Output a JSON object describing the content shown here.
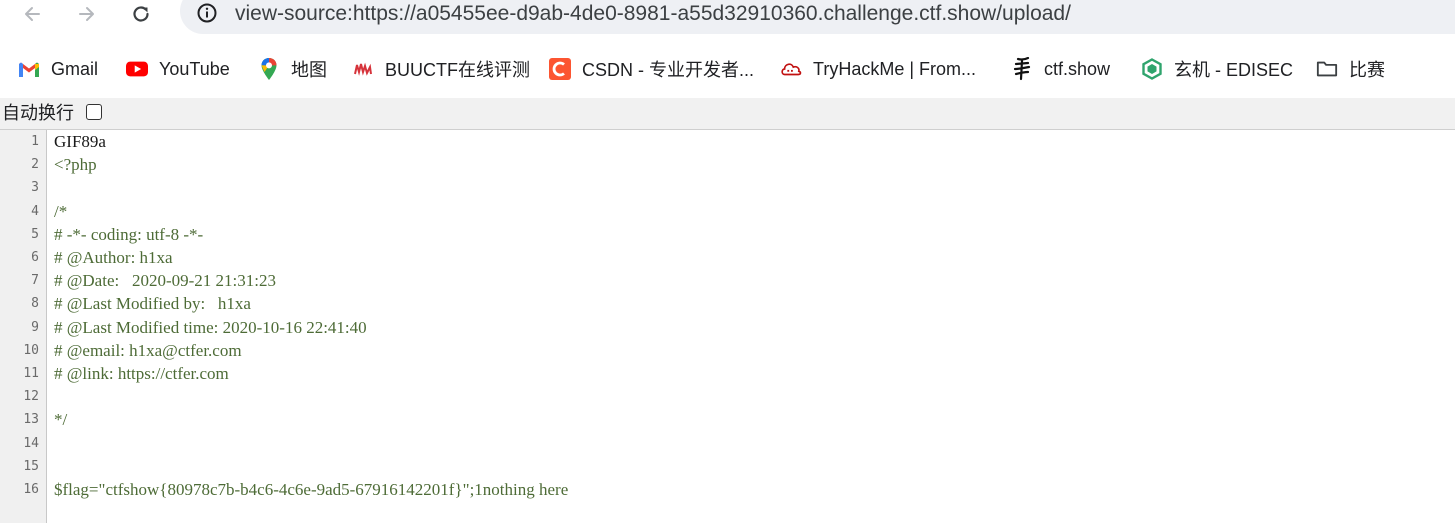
{
  "browser": {
    "url": "view-source:https://a05455ee-d9ab-4de0-8981-a55d32910360.challenge.ctf.show/upload/",
    "bookmarks": [
      {
        "label": "Gmail",
        "icon": "gmail-icon"
      },
      {
        "label": "YouTube",
        "icon": "youtube-icon"
      },
      {
        "label": "地图",
        "icon": "maps-icon"
      },
      {
        "label": "BUUCTF在线评测",
        "icon": "buuctf-icon"
      },
      {
        "label": "CSDN - 专业开发者...",
        "icon": "csdn-icon"
      },
      {
        "label": "TryHackMe | From...",
        "icon": "tryhackme-icon"
      },
      {
        "label": "ctf.show",
        "icon": "ctfshow-icon"
      },
      {
        "label": "玄机 - EDISEC",
        "icon": "edisec-icon"
      },
      {
        "label": "比赛",
        "icon": "folder-icon"
      }
    ]
  },
  "viewer": {
    "wrap_label": "自动换行",
    "wrap_checked": false
  },
  "source_lines": [
    {
      "num": "1",
      "text": "GIF89a",
      "style": "plain"
    },
    {
      "num": "2",
      "text": "<?php",
      "style": "php"
    },
    {
      "num": "3",
      "text": "",
      "style": "php"
    },
    {
      "num": "4",
      "text": "/*",
      "style": "php"
    },
    {
      "num": "5",
      "text": "# -*- coding: utf-8 -*-",
      "style": "php"
    },
    {
      "num": "6",
      "text": "# @Author: h1xa",
      "style": "php"
    },
    {
      "num": "7",
      "text": "# @Date:   2020-09-21 21:31:23",
      "style": "php"
    },
    {
      "num": "8",
      "text": "# @Last Modified by:   h1xa",
      "style": "php"
    },
    {
      "num": "9",
      "text": "# @Last Modified time: 2020-10-16 22:41:40",
      "style": "php"
    },
    {
      "num": "10",
      "text": "# @email: h1xa@ctfer.com",
      "style": "php"
    },
    {
      "num": "11",
      "text": "# @link: https://ctfer.com",
      "style": "php"
    },
    {
      "num": "12",
      "text": "",
      "style": "php"
    },
    {
      "num": "13",
      "text": "*/",
      "style": "php"
    },
    {
      "num": "14",
      "text": "",
      "style": "php"
    },
    {
      "num": "15",
      "text": "",
      "style": "php"
    },
    {
      "num": "16",
      "text": "$flag=\"ctfshow{80978c7b-b4c6-4c6e-9ad5-67916142201f}\";1nothing here",
      "style": "php"
    }
  ]
}
